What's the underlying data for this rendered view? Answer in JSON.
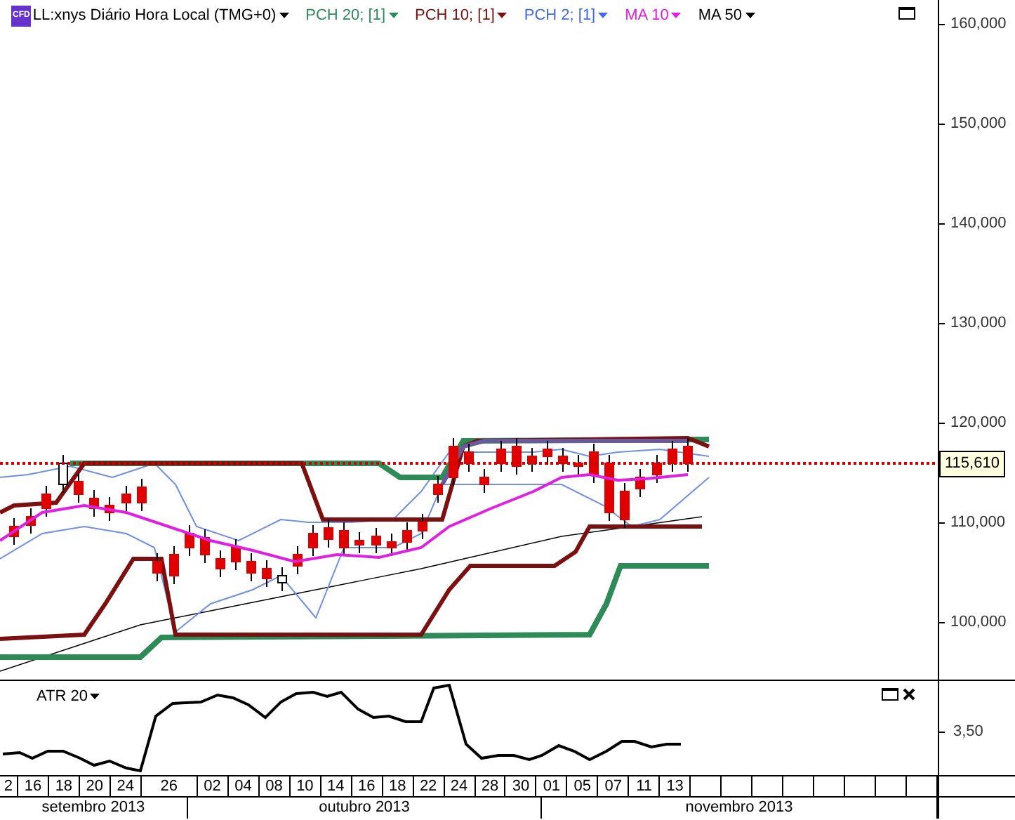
{
  "legend": [
    {
      "label": "LL:xnys Diário Hora Local (TMG+0)",
      "color": "#000000",
      "badge": "CFD"
    },
    {
      "label": "PCH 20; [1]",
      "color": "#2e8b57"
    },
    {
      "label": "PCH 10; [1]",
      "color": "#7b1010"
    },
    {
      "label": "PCH 2; [1]",
      "color": "#4169e1"
    },
    {
      "label": "MA 10",
      "color": "#e020e0"
    },
    {
      "label": "MA 50",
      "color": "#000000"
    }
  ],
  "price_axis": {
    "labels": [
      "160,000",
      "150,000",
      "140,000",
      "130,000",
      "120,000",
      "110,000",
      "100,000"
    ],
    "current_price": "115,610"
  },
  "atr_pane": {
    "label": "ATR 20",
    "axis_label": "3,50"
  },
  "dates": [
    "2",
    "16",
    "18",
    "20",
    "24",
    "26",
    "02",
    "04",
    "08",
    "10",
    "14",
    "16",
    "18",
    "22",
    "24",
    "28",
    "30",
    "01",
    "05",
    "07",
    "11",
    "13"
  ],
  "months": [
    "setembro 2013",
    "outubro 2013",
    "novembro 2013"
  ]
}
